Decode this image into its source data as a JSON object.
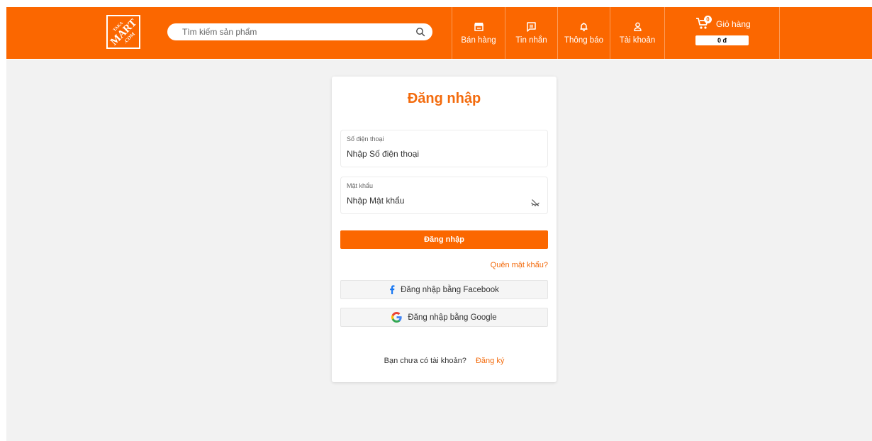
{
  "header": {
    "search": {
      "placeholder": "Tìm kiếm sản phẩm",
      "value": ""
    },
    "nav": [
      {
        "label": "Bán hàng",
        "icon": "store-icon"
      },
      {
        "label": "Tin nhắn",
        "icon": "message-icon"
      },
      {
        "label": "Thông báo",
        "icon": "bell-icon"
      },
      {
        "label": "Tài khoản",
        "icon": "user-icon"
      }
    ],
    "cart": {
      "label": "Giỏ hàng",
      "count": "0",
      "total": "0 đ"
    }
  },
  "login": {
    "title": "Đăng nhập",
    "phone": {
      "label": "Số điện thoại",
      "placeholder": "Nhập Số điện thoại",
      "value": ""
    },
    "password": {
      "label": "Mật khẩu",
      "placeholder": "Nhập Mật khẩu",
      "value": ""
    },
    "submit_label": "Đăng nhập",
    "forgot_label": "Quên mật khẩu?",
    "facebook_label": "Đăng nhập bằng Facebook",
    "google_label": "Đăng nhập bằng Google",
    "no_account_text": "Bạn chưa có tài khoản?",
    "signup_label": "Đăng ký"
  },
  "colors": {
    "brand": "#fb6700",
    "accent_text": "#f36b0d",
    "background": "#f2f2f2",
    "facebook": "#1877f2"
  }
}
